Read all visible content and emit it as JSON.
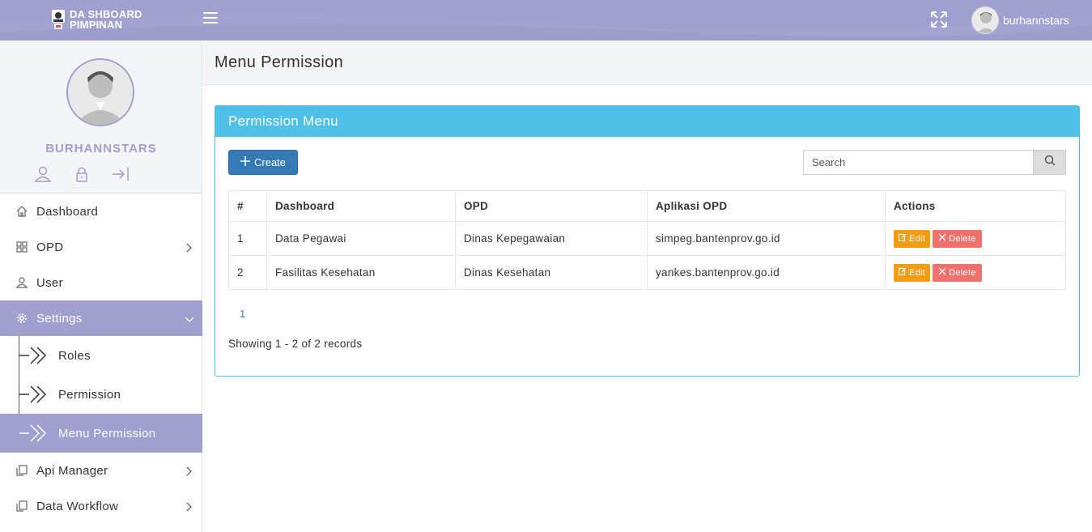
{
  "topbar": {
    "brand_line1": "DA SHBOARD",
    "brand_line2": "PIMPINAN",
    "username": "burhannstars",
    "icons": [
      "menu-icon",
      "fullscreen-icon",
      "avatar"
    ]
  },
  "sidebar": {
    "profile_name": "BURHANNSTARS",
    "profile_actions": [
      "user-icon",
      "lock-icon",
      "logout-icon"
    ],
    "items": [
      {
        "label": "Dashboard",
        "icon": "home-icon"
      },
      {
        "label": "OPD",
        "icon": "grid-icon"
      },
      {
        "label": "User",
        "icon": "user-icon"
      },
      {
        "label": "Settings",
        "icon": "gear-icon"
      },
      {
        "label": "Api Manager",
        "icon": "copy-icon"
      },
      {
        "label": "Data Workflow",
        "icon": "copy-icon"
      }
    ],
    "settings_sub": [
      {
        "label": "Roles"
      },
      {
        "label": "Permission"
      },
      {
        "label": "Menu Permission"
      }
    ]
  },
  "page": {
    "title": "Menu Permission"
  },
  "panel": {
    "title": "Permission Menu",
    "create_label": "Create",
    "search_placeholder": "Search",
    "columns": [
      "#",
      "Dashboard",
      "OPD",
      "Aplikasi OPD",
      "Actions"
    ],
    "rows": [
      {
        "no": "1",
        "dashboard": "Data Pegawai",
        "opd": "Dinas Kepegawaian",
        "aplikasi": "simpeg.bantenprov.go.id"
      },
      {
        "no": "2",
        "dashboard": "Fasilitas Kesehatan",
        "opd": "Dinas Kesehatan",
        "aplikasi": "yankes.bantenprov.go.id"
      }
    ],
    "edit_label": "Edit",
    "delete_label": "Delete",
    "page_number": "1",
    "records_text": "Showing 1 - 2 of 2 records"
  },
  "colors": {
    "accent": "#9f9fd0",
    "panel_header": "#4fc1e9",
    "create_button": "#337ab7",
    "edit_button": "#f39c12",
    "delete_button": "#f0706b"
  }
}
